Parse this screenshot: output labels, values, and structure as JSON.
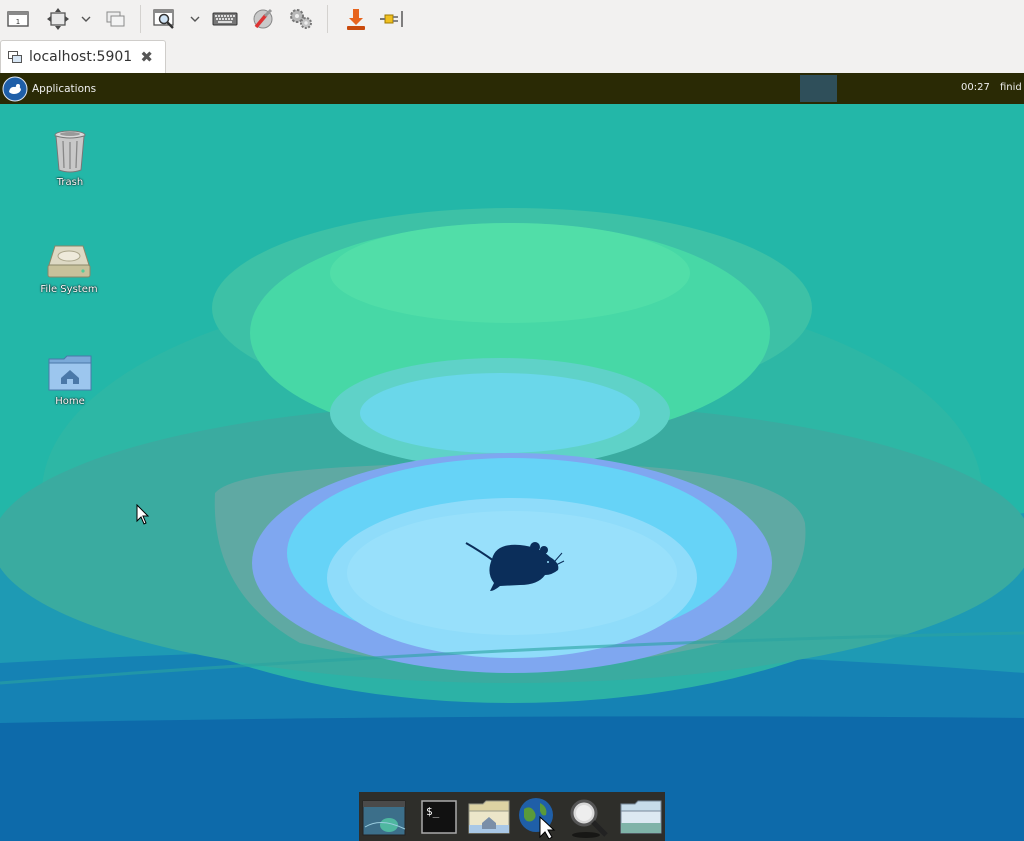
{
  "viewer": {
    "toolbar": {
      "items": [
        {
          "name": "screen-icon"
        },
        {
          "name": "fullscreen-icon"
        },
        {
          "name": "dropdown-icon"
        },
        {
          "name": "windows-icon"
        },
        {
          "name": "zoom-icon"
        },
        {
          "name": "dropdown-icon"
        },
        {
          "name": "keyboard-icon"
        },
        {
          "name": "tools-icon"
        },
        {
          "name": "settings-icon"
        },
        {
          "name": "transfer-icon"
        },
        {
          "name": "disconnect-icon"
        }
      ]
    },
    "tab": {
      "title": "localhost:5901",
      "close_glyph": "✖"
    }
  },
  "remote": {
    "panel": {
      "applications_label": "Applications",
      "clock": "00:27",
      "user": "finid"
    },
    "desktop_icons": [
      {
        "label": "Trash",
        "icon": "trash-icon"
      },
      {
        "label": "File System",
        "icon": "harddrive-icon"
      },
      {
        "label": "Home",
        "icon": "home-folder-icon"
      }
    ],
    "dock": [
      {
        "name": "show-desktop-icon"
      },
      {
        "name": "terminal-icon"
      },
      {
        "name": "file-manager-icon"
      },
      {
        "name": "web-browser-icon"
      },
      {
        "name": "app-finder-icon"
      },
      {
        "name": "folder-icon"
      }
    ],
    "colors": {
      "panel_bg": "#2a2a05",
      "desktop_teal": "#23b7a8",
      "desktop_blue": "#0f6aa8",
      "mouse_navy": "#0b2e5a"
    }
  }
}
